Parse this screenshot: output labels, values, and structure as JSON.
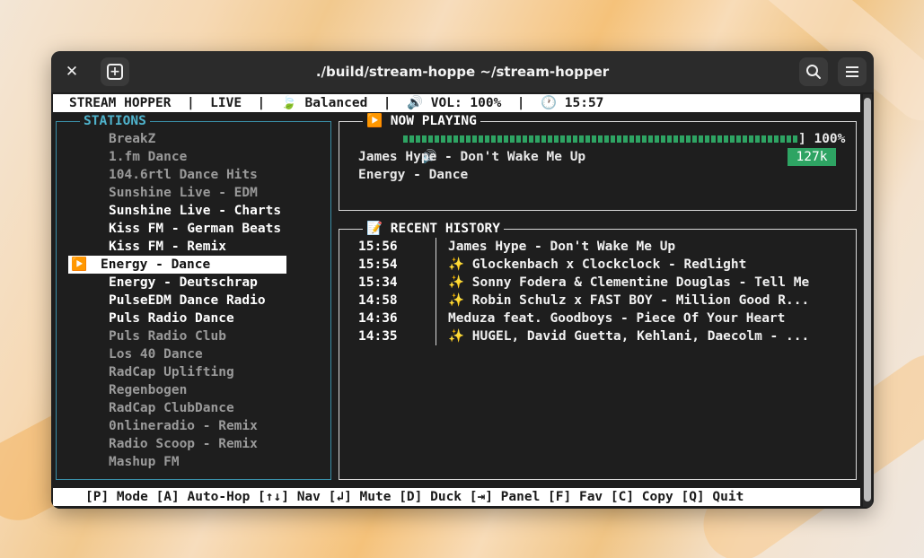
{
  "window": {
    "title": "./build/stream-hoppe ~/stream-hopper",
    "close_glyph": "✕",
    "newtab_glyph": "+",
    "search_icon": "search-icon",
    "menu_icon": "hamburger-menu-icon"
  },
  "statusbar": {
    "text": "STREAM HOPPER  |  LIVE  |  🍃 Balanced  |  🔊 VOL: 100%  |  🕐 15:57"
  },
  "stations": {
    "title": "STATIONS",
    "items": [
      {
        "label": "BreakZ",
        "style": "dim"
      },
      {
        "label": "1.fm Dance",
        "style": "dim"
      },
      {
        "label": "104.6rtl Dance Hits",
        "style": "dim"
      },
      {
        "label": "Sunshine Live - EDM",
        "style": "dim"
      },
      {
        "label": "Sunshine Live - Charts",
        "style": "bright"
      },
      {
        "label": "Kiss FM - German Beats",
        "style": "bright"
      },
      {
        "label": "Kiss FM - Remix",
        "style": "bright"
      },
      {
        "label": "Energy - Dance",
        "style": "selected"
      },
      {
        "label": "Energy - Deutschrap",
        "style": "bright"
      },
      {
        "label": "PulseEDM Dance Radio",
        "style": "bright"
      },
      {
        "label": "Puls Radio Dance",
        "style": "bright"
      },
      {
        "label": "Puls Radio Club",
        "style": "dim"
      },
      {
        "label": "Los 40 Dance",
        "style": "dim"
      },
      {
        "label": "RadCap Uplifting",
        "style": "dim"
      },
      {
        "label": "Regenbogen",
        "style": "dim"
      },
      {
        "label": "RadCap ClubDance",
        "style": "dim"
      },
      {
        "label": "0nlineradio - Remix",
        "style": "dim"
      },
      {
        "label": "Radio Scoop - Remix",
        "style": "dim"
      },
      {
        "label": "Mashup FM",
        "style": "dim"
      }
    ],
    "playing_indicator": "▶️"
  },
  "now_playing": {
    "title": "▶️ NOW PLAYING",
    "speaker_glyph": "🔊",
    "volume_level": 1.0,
    "volume_end": "] 100%",
    "track": "James Hype - Don't Wake Me Up",
    "station": "Energy - Dance",
    "bitrate": "127k"
  },
  "history": {
    "title": "📝 RECENT HISTORY",
    "rows": [
      {
        "time": "15:56",
        "track": "James Hype - Don't Wake Me Up",
        "spark": ""
      },
      {
        "time": "15:54",
        "track": "Glockenbach x Clockclock - Redlight",
        "spark": "✨ "
      },
      {
        "time": "15:34",
        "track": "Sonny Fodera & Clementine Douglas - Tell Me",
        "spark": "✨ "
      },
      {
        "time": "14:58",
        "track": "Robin Schulz x FAST BOY - Million Good R...",
        "spark": "✨ "
      },
      {
        "time": "14:36",
        "track": "Meduza feat. Goodboys - Piece Of Your Heart",
        "spark": ""
      },
      {
        "time": "14:35",
        "track": "HUGEL, David Guetta, Kehlani, Daecolm - ...",
        "spark": "✨ "
      }
    ]
  },
  "footer": {
    "text": "[P] Mode [A] Auto-Hop [↑↓] Nav [↲] Mute [D] Duck [⇥] Panel [F] Fav [C] Copy [Q] Quit"
  }
}
